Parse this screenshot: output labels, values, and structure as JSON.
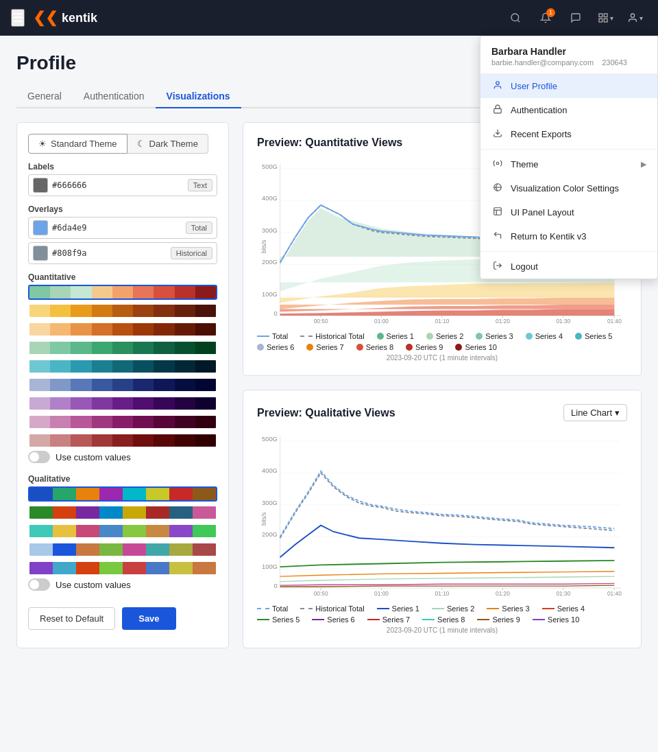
{
  "nav": {
    "hamburger": "☰",
    "logo_text": "kentik",
    "logo_chevron": "❯❯",
    "notification_count": "1",
    "icons": [
      "search",
      "bell",
      "chat",
      "grid",
      "user"
    ]
  },
  "dropdown": {
    "user_name": "Barbara Handler",
    "user_email": "barbie.handler@company.com",
    "user_id": "230643",
    "items": [
      {
        "id": "user-profile",
        "label": "User Profile",
        "icon": "👤",
        "active": true
      },
      {
        "id": "authentication",
        "label": "Authentication",
        "icon": "🔑",
        "active": false
      },
      {
        "id": "recent-exports",
        "label": "Recent Exports",
        "icon": "📥",
        "active": false
      },
      {
        "id": "theme",
        "label": "Theme",
        "icon": "⚙️",
        "arrow": "▶",
        "active": false
      },
      {
        "id": "visualization-color",
        "label": "Visualization Color Settings",
        "icon": "🎨",
        "active": false
      },
      {
        "id": "ui-panel-layout",
        "label": "UI Panel Layout",
        "icon": "▦",
        "active": false
      },
      {
        "id": "return-kentik",
        "label": "Return to Kentik v3",
        "icon": "↩",
        "active": false
      },
      {
        "id": "logout",
        "label": "Logout",
        "icon": "⎋",
        "active": false
      }
    ]
  },
  "page": {
    "title": "Profile",
    "tabs": [
      {
        "id": "general",
        "label": "General"
      },
      {
        "id": "authentication",
        "label": "Authentication"
      },
      {
        "id": "visualizations",
        "label": "Visualizations",
        "active": true
      }
    ]
  },
  "left_panel": {
    "theme_buttons": [
      {
        "id": "standard",
        "label": "Standard Theme",
        "icon": "☀",
        "active": true
      },
      {
        "id": "dark",
        "label": "Dark Theme",
        "icon": "☾",
        "active": false
      }
    ],
    "labels_section": "Labels",
    "labels": [
      {
        "color": "#666666",
        "hex": "#666666",
        "tag": "Text"
      }
    ],
    "overlays_section": "Overlays",
    "overlays": [
      {
        "color": "#6da4e9",
        "hex": "#6da4e9",
        "tag": "Total"
      },
      {
        "color": "#808f9a",
        "hex": "#808f9a",
        "tag": "Historical"
      }
    ],
    "quantitative_section": "Quantitative",
    "quantitative_palettes": [
      [
        "#7ec8a4",
        "#a8d5b5",
        "#c5e8d5",
        "#f5c98e",
        "#f4a26b",
        "#e8745a",
        "#d94f3d",
        "#b8312b",
        "#8b1a1a"
      ],
      [
        "#f9d57a",
        "#f5c040",
        "#e89c1a",
        "#d47a12",
        "#b85c10",
        "#9c4210",
        "#82300e",
        "#66200c",
        "#4a120a"
      ],
      [
        "#f9d5a0",
        "#f5b870",
        "#e89448",
        "#d47028",
        "#b85010",
        "#9c3808",
        "#822806",
        "#661a04",
        "#4a0e02"
      ],
      [
        "#a8d5b5",
        "#7ec8a4",
        "#5ab88a",
        "#3aa870",
        "#2a9060",
        "#1a7850",
        "#0e6040",
        "#065030",
        "#024020"
      ],
      [
        "#6dc8d4",
        "#4ab5c5",
        "#2a9ab0",
        "#1a8090",
        "#106878",
        "#085060",
        "#043848",
        "#022838",
        "#011828"
      ],
      [
        "#a8b5d5",
        "#8098c8",
        "#5878b8",
        "#3858a0",
        "#284088",
        "#1a2870",
        "#0e1858",
        "#060e40",
        "#020630"
      ],
      [
        "#c8a8d5",
        "#b080c8",
        "#9858b8",
        "#8038a0",
        "#681e88",
        "#500e70",
        "#380658",
        "#220240",
        "#100030"
      ],
      [
        "#d5a8c8",
        "#c880b0",
        "#b85898",
        "#a03880",
        "#881e68",
        "#700e50",
        "#580638",
        "#400222",
        "#300010"
      ],
      [
        "#d5a8a8",
        "#c88080",
        "#b85858",
        "#a03838",
        "#881e1e",
        "#700e0e",
        "#580606",
        "#400202",
        "#300000"
      ]
    ],
    "use_custom_quantitative": "Use custom values",
    "qualitative_section": "Qualitative",
    "qualitative_palettes": [
      [
        "#1a4fc4",
        "#26a669",
        "#e8820c",
        "#9c28b0",
        "#00b8c8",
        "#c8c828",
        "#c82828",
        "#8b5a1a"
      ],
      [
        "#2a8a28",
        "#d44010",
        "#7828a0",
        "#0088c8",
        "#c8a808",
        "#a82828",
        "#286080",
        "#c85898"
      ],
      [
        "#40c8b8",
        "#e8c040",
        "#c84878",
        "#4888c8",
        "#88c840",
        "#c88840",
        "#8848c8",
        "#40c858"
      ],
      [
        "#a8c8e8",
        "#1a56db",
        "#c87840",
        "#78b840",
        "#c84898",
        "#40a8a8",
        "#a8a840",
        "#a84848"
      ],
      [
        "#8040c8",
        "#40a8c8",
        "#d44010",
        "#78c840",
        "#c84040",
        "#4878c8",
        "#c8c040",
        "#c87840"
      ]
    ],
    "use_custom_qualitative": "Use custom values",
    "reset_label": "Reset to Default",
    "save_label": "Save"
  },
  "chart1": {
    "title": "Preview: Quantitative Views",
    "x_label": "2023-09-20 UTC (1 minute intervals)",
    "y_labels": [
      "0",
      "100G",
      "200G",
      "300G",
      "400G",
      "500G"
    ],
    "x_ticks": [
      "00:50",
      "01:00",
      "01:10",
      "01:20",
      "01:30",
      "01:40"
    ],
    "legend": [
      {
        "type": "line",
        "color": "#6da4e9",
        "label": "Total"
      },
      {
        "type": "dashed",
        "color": "#808f9a",
        "label": "Historical Total"
      },
      {
        "type": "dot",
        "color": "#5ab88a",
        "label": "Series 1"
      },
      {
        "type": "dot",
        "color": "#a8d5b5",
        "label": "Series 2"
      },
      {
        "type": "dot",
        "color": "#7ec8a4",
        "label": "Series 3"
      },
      {
        "type": "dot",
        "color": "#6dc8d4",
        "label": "Series 4"
      },
      {
        "type": "dot",
        "color": "#4ab5c5",
        "label": "Series 5"
      },
      {
        "type": "dot",
        "color": "#a8b5d5",
        "label": "Series 6"
      },
      {
        "type": "dot",
        "color": "#e8820c",
        "label": "Series 7"
      },
      {
        "type": "dot",
        "color": "#d94f3d",
        "label": "Series 8"
      },
      {
        "type": "dot",
        "color": "#b8312b",
        "label": "Series 9"
      },
      {
        "type": "dot",
        "color": "#8b1a1a",
        "label": "Series 10"
      }
    ]
  },
  "chart2": {
    "title": "Preview: Qualitative Views",
    "type_label": "Line Chart",
    "x_label": "2023-09-20 UTC (1 minute intervals)",
    "y_labels": [
      "0",
      "100G",
      "200G",
      "300G",
      "400G",
      "500G"
    ],
    "x_ticks": [
      "00:50",
      "01:00",
      "01:10",
      "01:20",
      "01:30",
      "01:40"
    ],
    "legend": [
      {
        "type": "dashed",
        "color": "#6da4e9",
        "label": "Total"
      },
      {
        "type": "dashed",
        "color": "#808f9a",
        "label": "Historical Total"
      },
      {
        "type": "line",
        "color": "#1a4fc4",
        "label": "Series 1"
      },
      {
        "type": "line",
        "color": "#a8d5b5",
        "label": "Series 2"
      },
      {
        "type": "line",
        "color": "#e8820c",
        "label": "Series 3"
      },
      {
        "type": "line",
        "color": "#d44010",
        "label": "Series 4"
      },
      {
        "type": "line",
        "color": "#2a8a28",
        "label": "Series 5"
      },
      {
        "type": "line",
        "color": "#7828a0",
        "label": "Series 6"
      },
      {
        "type": "line",
        "color": "#c82828",
        "label": "Series 7"
      },
      {
        "type": "line",
        "color": "#40c8b8",
        "label": "Series 8"
      },
      {
        "type": "line",
        "color": "#8b5a1a",
        "label": "Series 9"
      },
      {
        "type": "line",
        "color": "#8040c8",
        "label": "Series 10"
      }
    ]
  }
}
